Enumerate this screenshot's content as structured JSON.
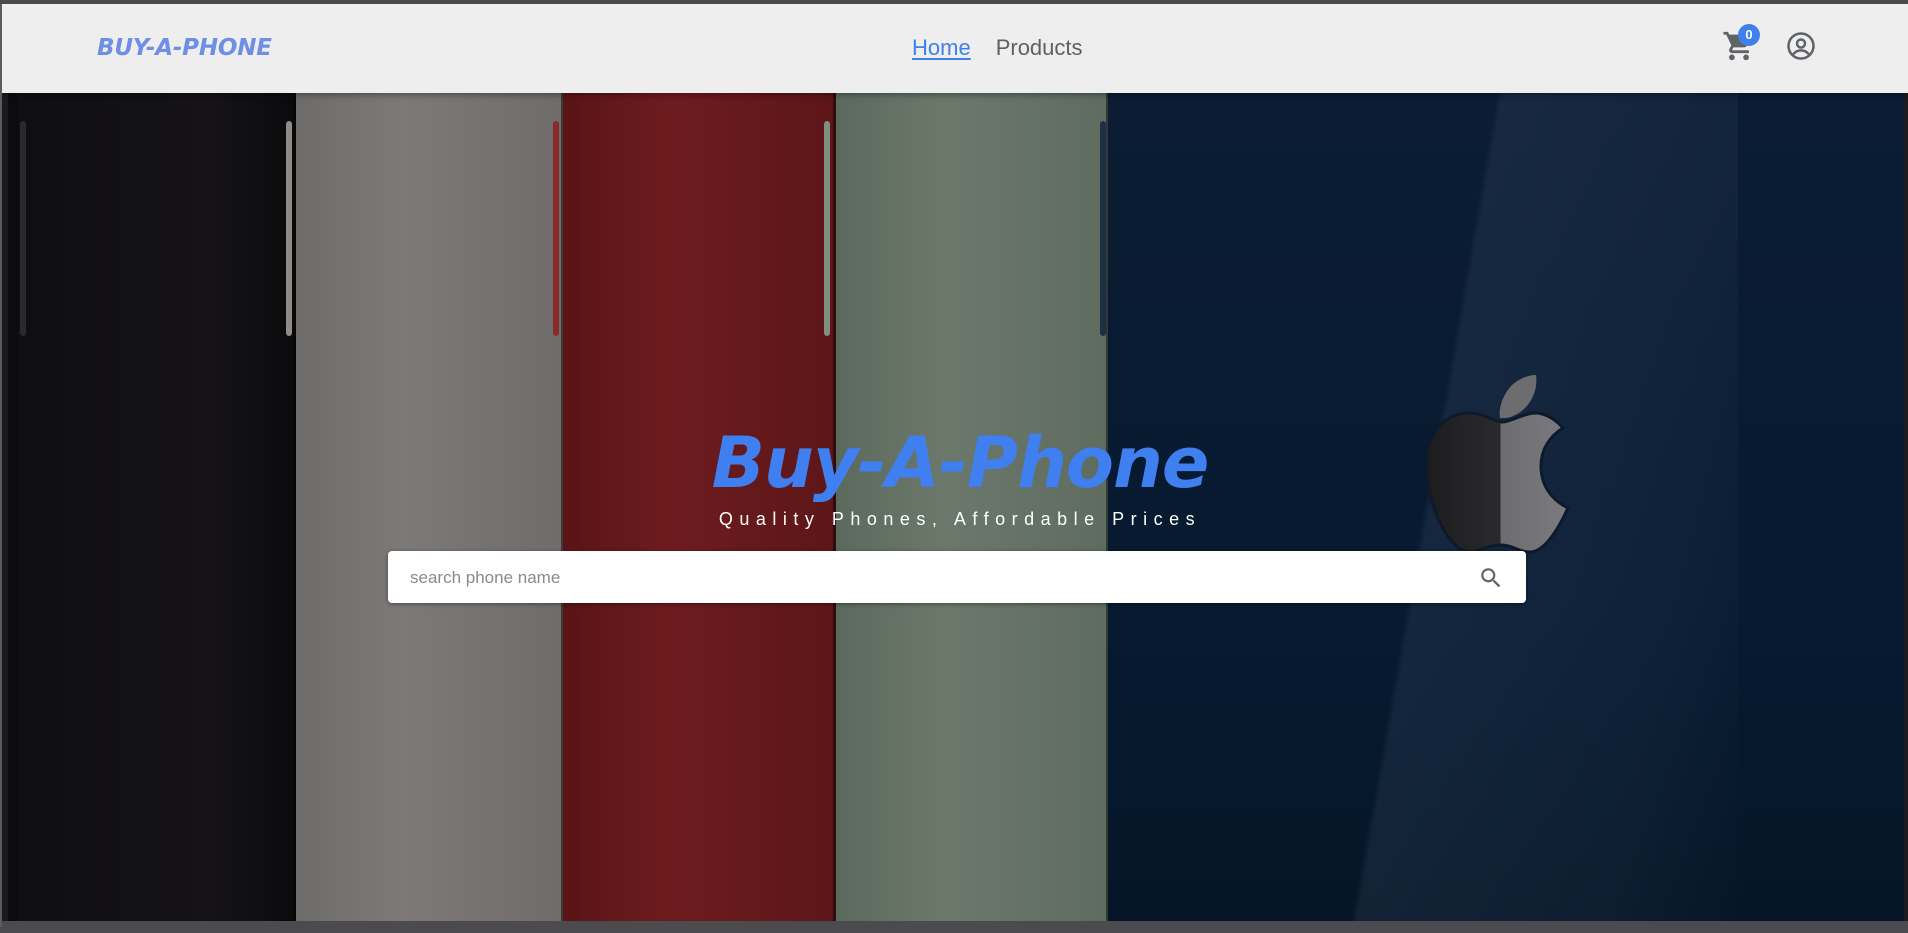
{
  "navbar": {
    "brand": "BUY-A-PHONE",
    "links": [
      {
        "label": "Home",
        "active": true
      },
      {
        "label": "Products",
        "active": false
      }
    ],
    "cart_count": "0",
    "icons": [
      "cart-icon",
      "account-circle-icon"
    ]
  },
  "hero": {
    "title": "Buy-A-Phone",
    "subtitle": "Quality Phones, Affordable Prices",
    "search": {
      "placeholder": "search phone name",
      "value": "",
      "icon": "search-icon"
    },
    "background_phone_colors": [
      "#121113",
      "#787574",
      "#6a1a1c",
      "#6a776a",
      "#081b31"
    ]
  },
  "colors": {
    "accent": "#3f80ea",
    "navbar_bg": "#eeeeee",
    "brand": "#6f8fe6"
  }
}
